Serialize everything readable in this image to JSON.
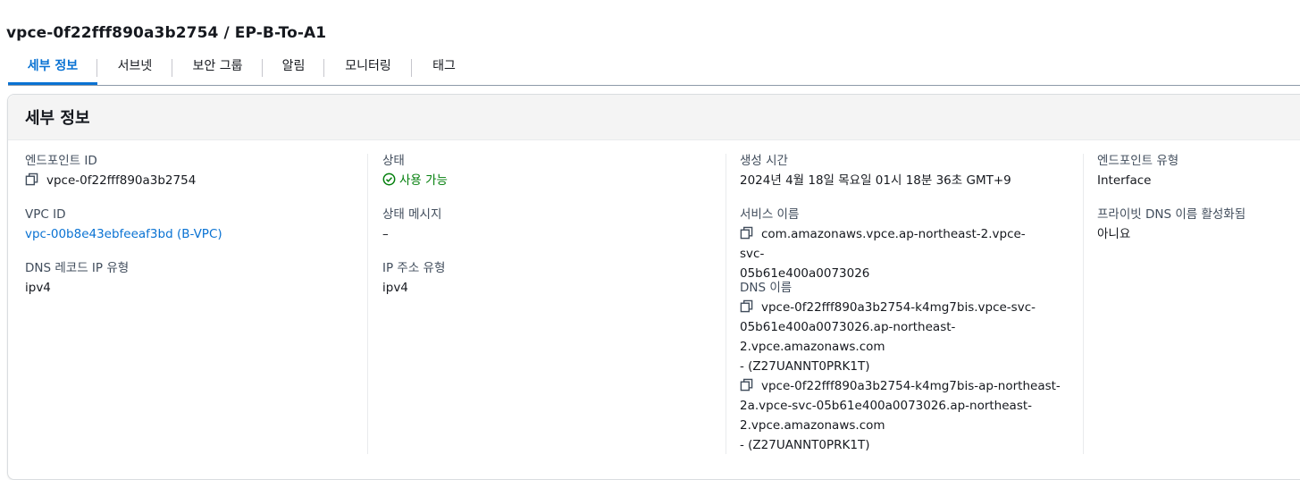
{
  "page": {
    "title": "vpce-0f22fff890a3b2754 / EP-B-To-A1"
  },
  "tabs": [
    {
      "label": "세부 정보"
    },
    {
      "label": "서브넷"
    },
    {
      "label": "보안 그룹"
    },
    {
      "label": "알림"
    },
    {
      "label": "모니터링"
    },
    {
      "label": "태그"
    }
  ],
  "panel": {
    "title": "세부 정보"
  },
  "col1": {
    "endpoint_id_label": "엔드포인트 ID",
    "endpoint_id_value": "vpce-0f22fff890a3b2754",
    "vpc_id_label": "VPC ID",
    "vpc_id_value": "vpc-00b8e43ebfeeaf3bd (B-VPC)",
    "dns_record_label": "DNS 레코드 IP 유형",
    "dns_record_value": "ipv4"
  },
  "col2": {
    "status_label": "상태",
    "status_value": "사용 가능",
    "status_message_label": "상태 메시지",
    "status_message_value": "–",
    "ip_type_label": "IP 주소 유형",
    "ip_type_value": "ipv4"
  },
  "col3": {
    "created_label": "생성 시간",
    "created_value": "2024년 4월 18일 목요일 01시 18분 36초 GMT+9",
    "service_name_label": "서비스 이름",
    "service_name_lines": [
      "com.amazonaws.vpce.ap-northeast-2.vpce-svc-",
      "05b61e400a0073026"
    ],
    "dns_names_label": "DNS 이름",
    "dns_names": [
      {
        "lines": [
          "vpce-0f22fff890a3b2754-k4mg7bis.vpce-svc-",
          "05b61e400a0073026.ap-northeast-",
          "2.vpce.amazonaws.com",
          "- (Z27UANNT0PRK1T)"
        ]
      },
      {
        "lines": [
          "vpce-0f22fff890a3b2754-k4mg7bis-ap-northeast-",
          "2a.vpce-svc-05b61e400a0073026.ap-northeast-",
          "2.vpce.amazonaws.com",
          "- (Z27UANNT0PRK1T)"
        ]
      }
    ]
  },
  "col4": {
    "endpoint_type_label": "엔드포인트 유형",
    "endpoint_type_value": "Interface",
    "private_dns_label": "프라이빗 DNS 이름 활성화됨",
    "private_dns_value": "아니요"
  },
  "colors": {
    "accent": "#0972d3",
    "success": "#037f0c"
  },
  "icons": {
    "copy": "copy-icon",
    "status": "check-circle-icon"
  }
}
